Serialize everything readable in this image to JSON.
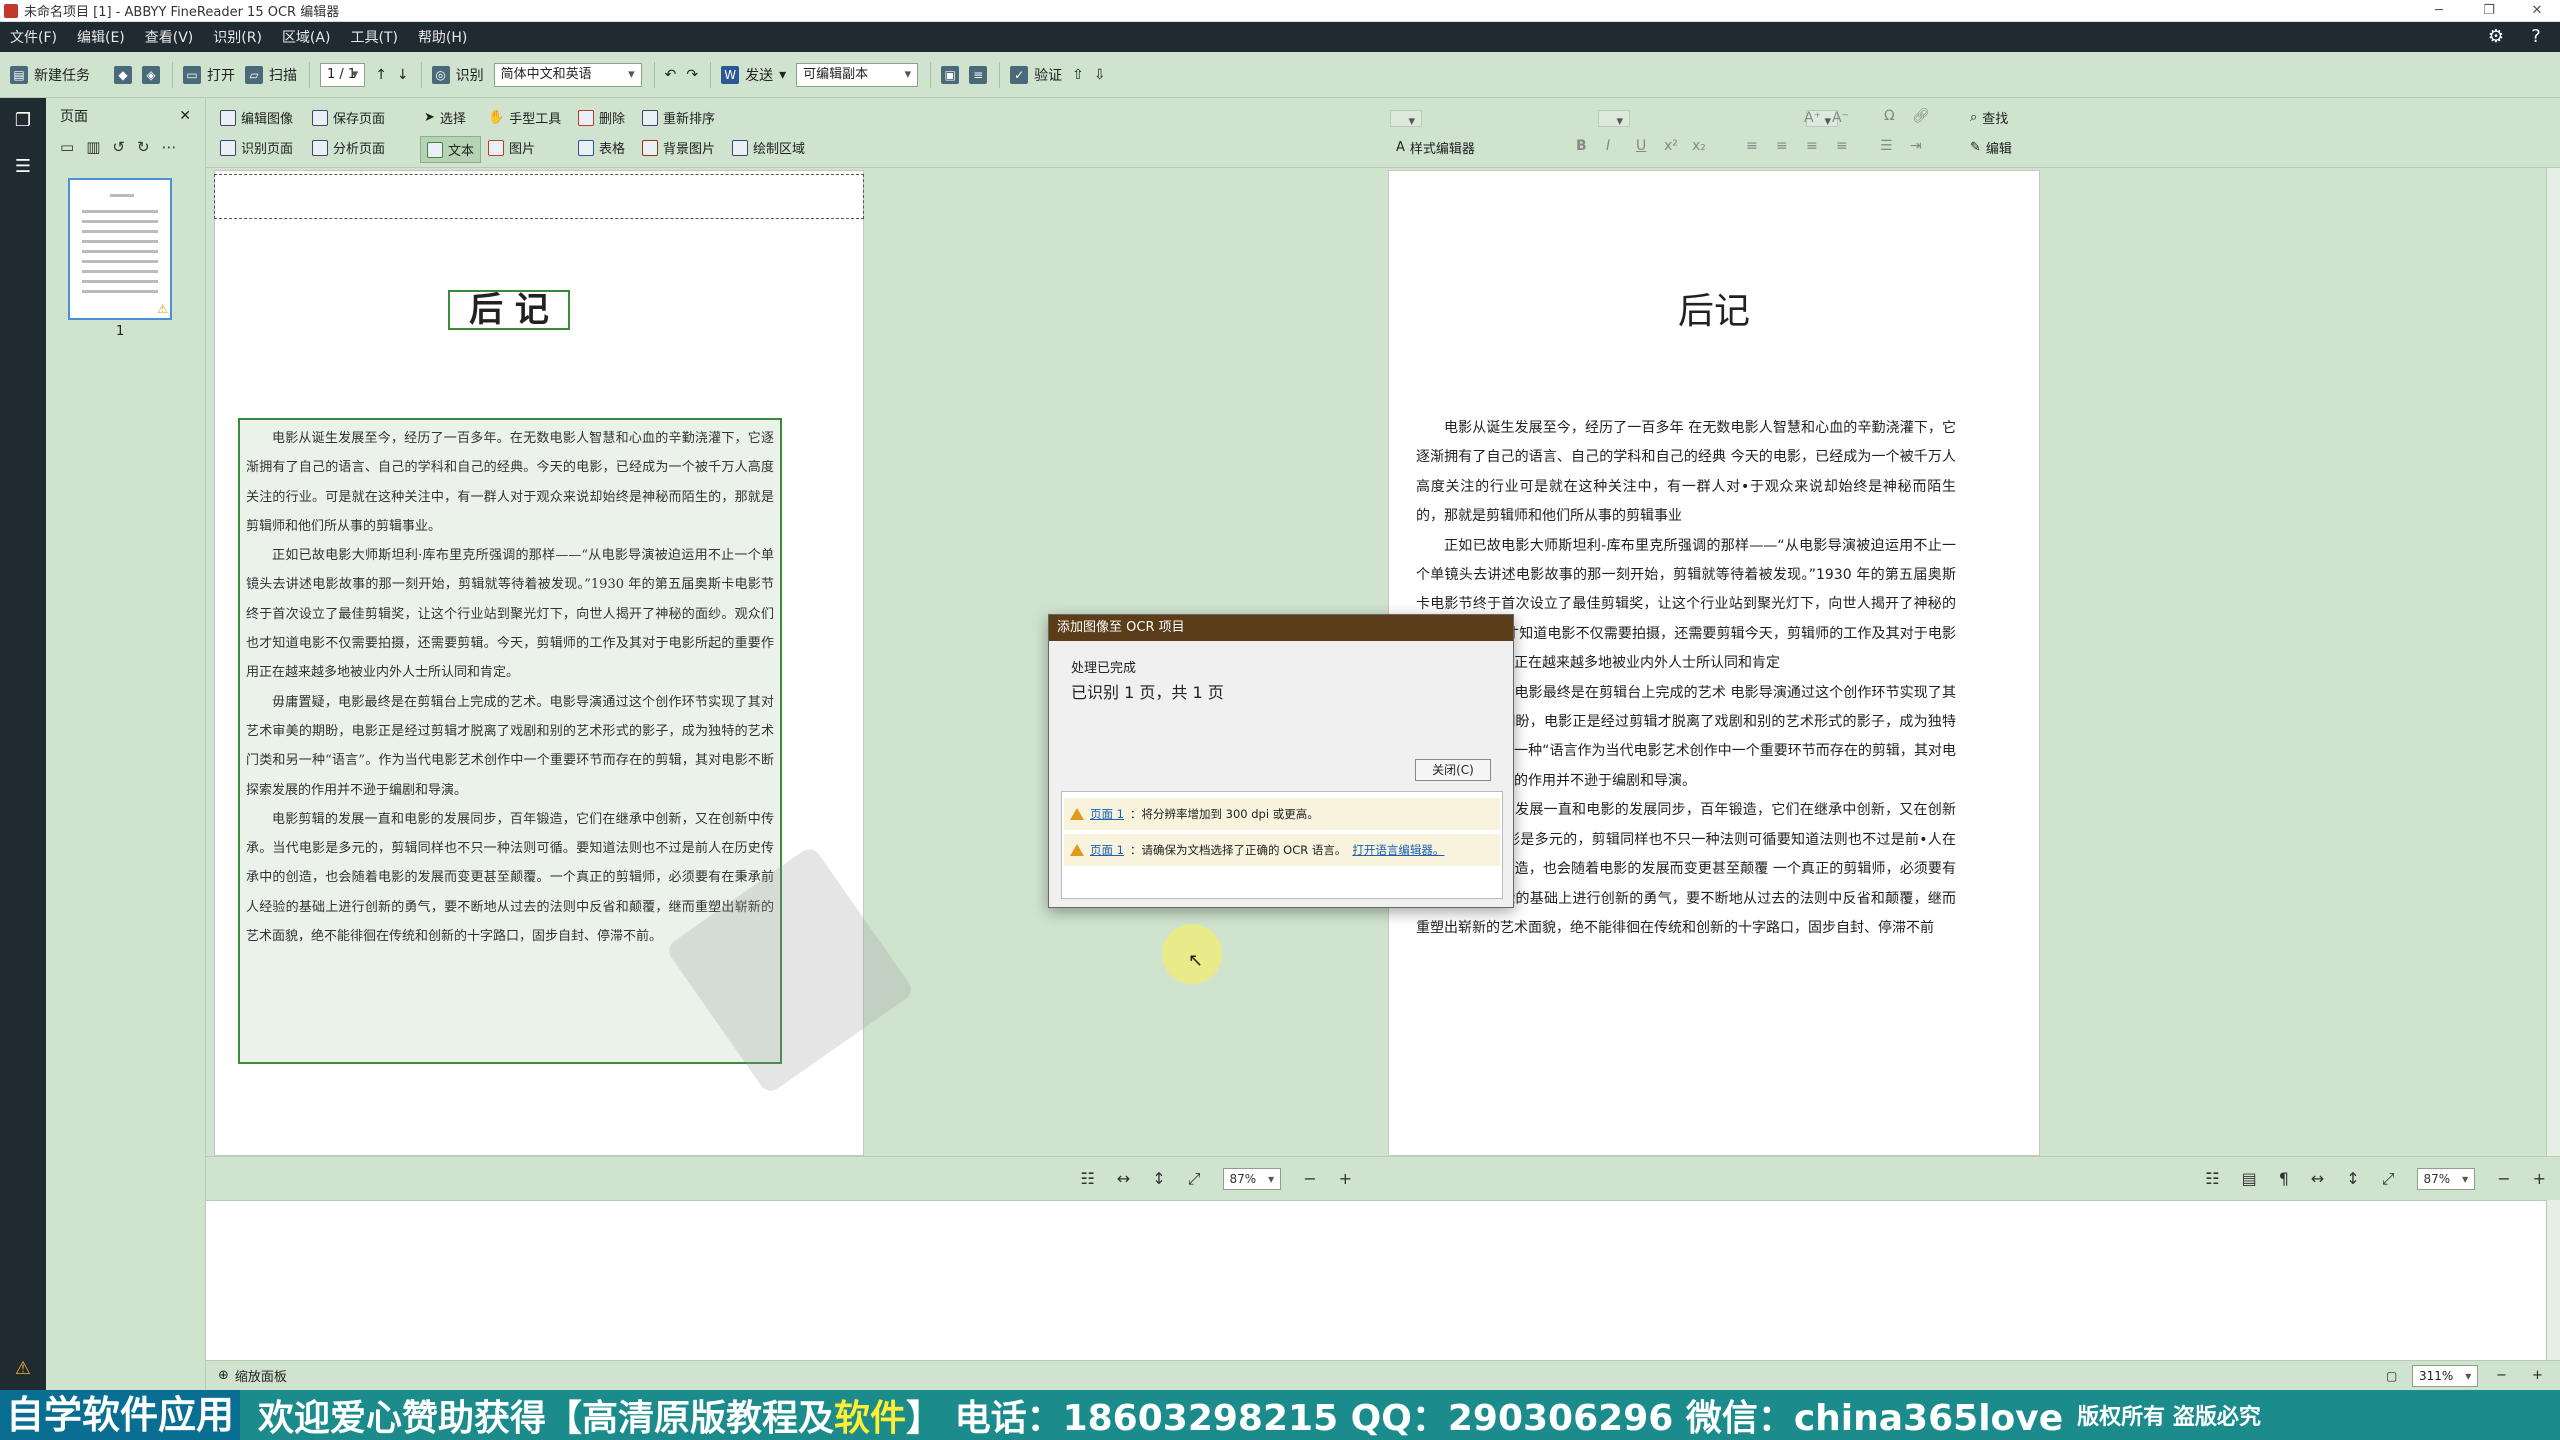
{
  "window": {
    "title": "未命名项目 [1] - ABBYY FineReader 15 OCR 编辑器",
    "minimize": "─",
    "maximize": "❐",
    "close": "✕"
  },
  "menu": [
    "文件(F)",
    "编辑(E)",
    "查看(V)",
    "识别(R)",
    "区域(A)",
    "工具(T)",
    "帮助(H)"
  ],
  "toolbar": {
    "new_task": "新建任务",
    "open": "打开",
    "scan": "扫描",
    "page_nav": "1 / 1",
    "recognize": "识别",
    "language": "简体中文和英语",
    "send": "发送",
    "send_format": "可编辑副本",
    "verify": "验证"
  },
  "page_panel": {
    "title": "页面",
    "close": "✕",
    "thumb_number": "1"
  },
  "image_tools": {
    "edit_image": "编辑图像",
    "save_page": "保存页面",
    "recognize_page": "识别页面",
    "analyze_page": "分析页面",
    "select": "选择",
    "hand_tool": "手型工具",
    "delete": "删除",
    "reorder": "重新排序",
    "text": "文本",
    "picture": "图片",
    "table": "表格",
    "background_picture": "背景图片",
    "draw_area": "绘制区域"
  },
  "text_tools": {
    "style_editor": "样式编辑器",
    "find": "查找",
    "edit": "编辑"
  },
  "image_page": {
    "title": "后  记",
    "paragraphs": [
      "电影从诞生发展至今，经历了一百多年。在无数电影人智慧和心血的辛勤浇灌下，它逐渐拥有了自己的语言、自己的学科和自己的经典。今天的电影，已经成为一个被千万人高度关注的行业。可是就在这种关注中，有一群人对于观众来说却始终是神秘而陌生的，那就是剪辑师和他们所从事的剪辑事业。",
      "正如已故电影大师斯坦利·库布里克所强调的那样——“从电影导演被迫运用不止一个单镜头去讲述电影故事的那一刻开始，剪辑就等待着被发现。”1930 年的第五届奥斯卡电影节终于首次设立了最佳剪辑奖，让这个行业站到聚光灯下，向世人揭开了神秘的面纱。观众们也才知道电影不仅需要拍摄，还需要剪辑。今天，剪辑师的工作及其对于电影所起的重要作用正在越来越多地被业内外人士所认同和肯定。",
      "毋庸置疑，电影最终是在剪辑台上完成的艺术。电影导演通过这个创作环节实现了其对艺术审美的期盼，电影正是经过剪辑才脱离了戏剧和别的艺术形式的影子，成为独特的艺术门类和另一种“语言”。作为当代电影艺术创作中一个重要环节而存在的剪辑，其对电影不断探索发展的作用并不逊于编剧和导演。",
      "电影剪辑的发展一直和电影的发展同步，百年锻造，它们在继承中创新，又在创新中传承。当代电影是多元的，剪辑同样也不只一种法则可循。要知道法则也不过是前人在历史传承中的创造，也会随着电影的发展而变更甚至颠覆。一个真正的剪辑师，必须要有在秉承前人经验的基础上进行创新的勇气，要不断地从过去的法则中反省和颠覆，继而重塑出崭新的艺术面貌，绝不能徘徊在传统和创新的十字路口，固步自封、停滞不前。"
    ]
  },
  "text_page": {
    "title": "后记",
    "paragraphs": [
      "电影从诞生发展至今，经历了一百多年 在无数电影人智慧和心血的辛勤浇灌下，它逐渐拥有了自己的语言、自己的学科和自己的经典 今天的电影，已经成为一个被千万人高度关注的行业可是就在这种关注中，有一群人对•于观众来说却始终是神秘而陌生的，那就是剪辑师和他们所从事的剪辑事业",
      "正如已故电影大师斯坦利-库布里克所强调的那样——“从电影导演被迫运用不止一个单镜头去讲述电影故事的那一刻开始，剪辑就等待着被发现。”1930 年的第五届奥斯卡电影节终于首次设立了最佳剪辑奖，让这个行业站到聚光灯下，向世人揭开了神秘的面纱 观众们也才知道电影不仅需要拍摄，还需要剪辑今天，剪辑师的工作及其对于电影所起的重要作用正在越来越多地被业内外人士所认同和肯定",
      "毋庸置疑，电影最终是在剪辑台上完成的艺术 电影导演通过这个创作环节实现了其对艺术审美的期盼，电影正是经过剪辑才脱离了戏剧和别的艺术形式的影子，成为独特的艺术门类和另一种“语言作为当代电影艺术创作中一个重要环节而存在的剪辑，其对电影不断探索发展的作用并不逊于编剧和导演。",
      "电影剪辑的发展一直和电影的发展同步，百年锻造，它们在继承中创新，又在创新中传承 当代电影是多元的，剪辑同样也不只一种法则可循要知道法则也不过是前•人在历史传承中的创造，也会随着电影的发展而变更甚至颠覆 一个真正的剪辑师，必须要有在秉承前人经验的基础上进行创新的勇气，要不断地从过去的法则中反省和颠覆，继而重塑出崭新的艺术面貌，绝不能徘徊在传统和创新的十字路口，固步自封、停滞不前"
    ]
  },
  "zoom": {
    "image_zoom": "87%",
    "text_zoom": "87%",
    "panel_zoom": "311%",
    "minus": "−",
    "plus": "+"
  },
  "status": {
    "zoom_panel": "缩放面板"
  },
  "dialog": {
    "title": "添加图像至 OCR 项目",
    "status": "处理已完成",
    "result": "已识别 1 页，共 1 页",
    "close_button": "关闭(C)",
    "warnings": [
      {
        "page_link": "页面 1",
        "text": "：将分辨率增加到 300 dpi 或更高。",
        "extra_link": ""
      },
      {
        "page_link": "页面 1",
        "text": "：请确保为文档选择了正确的 OCR 语言。",
        "extra_link": "打开语言编辑器。"
      }
    ]
  },
  "banner": {
    "part1": "自学软件应用",
    "part2": "欢迎爱心赞助获得【高清原版教程及",
    "part3": "软件",
    "part4": "】 电话：18603298215 QQ：290306296 微信：china365love",
    "part5": "版权所有 盗版必究"
  },
  "icons": {
    "settings": "gear-icon",
    "help": "help-icon",
    "accent": "#1f2b30",
    "panel_bg": "#cfe3cf",
    "region_green": "#3a8a3a",
    "dialog_title_bg": "#5c3d1a"
  }
}
